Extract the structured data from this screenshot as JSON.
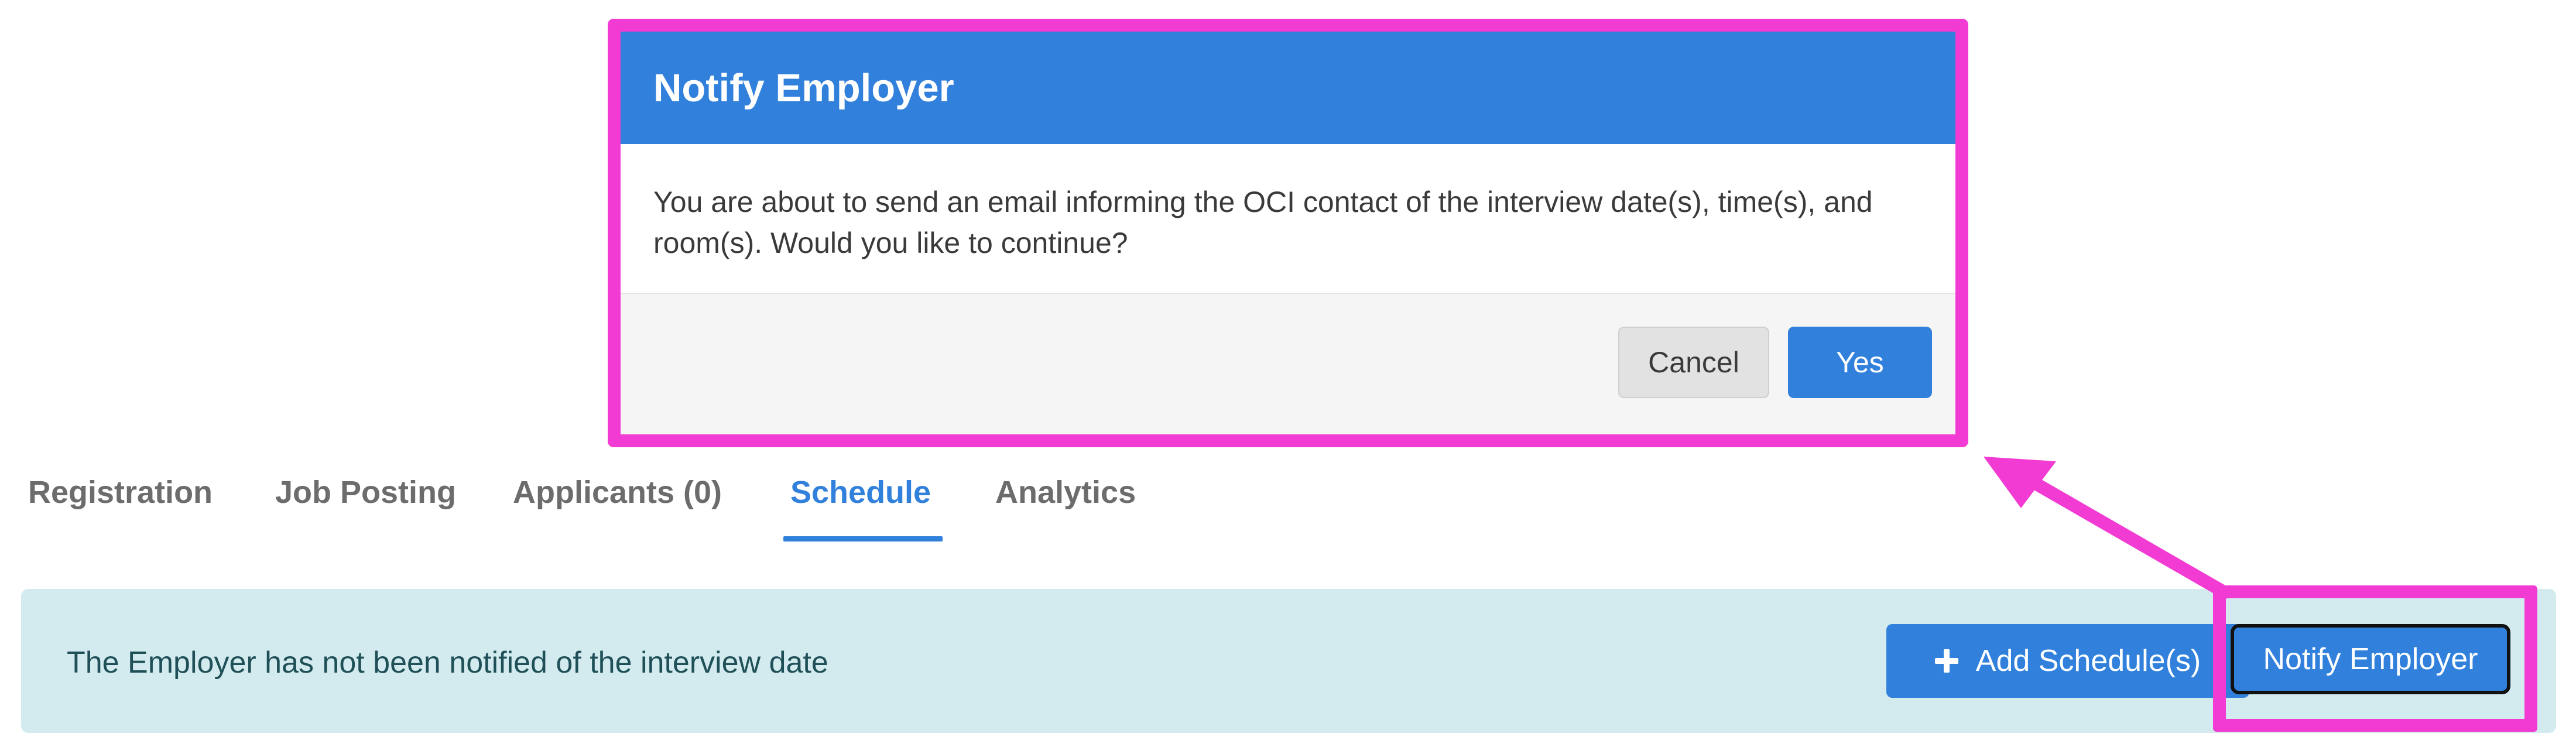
{
  "modal": {
    "title": "Notify Employer",
    "message": "You are about to send an email informing the OCI contact of the interview date(s), time(s), and room(s). Would you like to continue?",
    "cancel_label": "Cancel",
    "confirm_label": "Yes"
  },
  "tabs": [
    {
      "label": "Registration",
      "active": false
    },
    {
      "label": "Job Posting",
      "active": false
    },
    {
      "label": "Applicants (0)",
      "active": false
    },
    {
      "label": "Schedule",
      "active": true
    },
    {
      "label": "Analytics",
      "active": false
    }
  ],
  "schedule_bar": {
    "status_text": "The Employer has not been notified of the interview date",
    "add_button_label": "Add Schedule(s)",
    "add_button_icon": "plus-icon",
    "notify_button_label": "Notify Employer"
  },
  "colors": {
    "primary": "#3181dc",
    "highlight": "#f23bd3",
    "info_bar_bg": "#d3ebef"
  }
}
